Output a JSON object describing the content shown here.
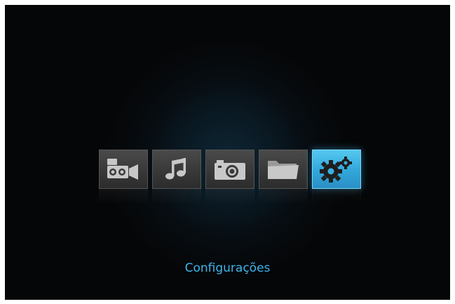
{
  "menu": {
    "items": [
      {
        "key": "video",
        "icon": "video-camera-icon",
        "selected": false
      },
      {
        "key": "music",
        "icon": "music-note-icon",
        "selected": false
      },
      {
        "key": "photo",
        "icon": "photo-camera-icon",
        "selected": false
      },
      {
        "key": "file",
        "icon": "folder-icon",
        "selected": false
      },
      {
        "key": "settings",
        "icon": "gears-icon",
        "selected": true
      }
    ],
    "selected_label": "Configurações"
  },
  "colors": {
    "background": "#050607",
    "accent": "#34a9dc",
    "label": "#3fb4ea",
    "tile": "#3a3a3a",
    "icon": "#c8c8c8"
  }
}
